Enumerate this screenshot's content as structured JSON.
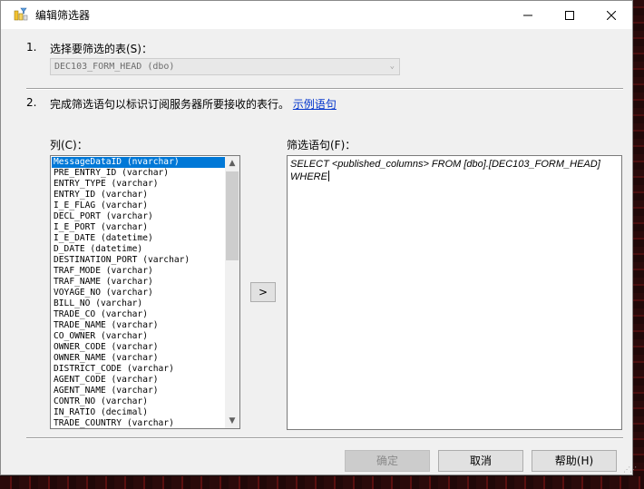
{
  "window": {
    "title": "编辑筛选器"
  },
  "step1": {
    "number": "1.",
    "label": "选择要筛选的表(S)：",
    "table_value": "DEC103_FORM_HEAD (dbo)"
  },
  "step2": {
    "number": "2.",
    "label": "完成筛选语句以标识订阅服务器所要接收的表行。",
    "link": "示例语句"
  },
  "columns": {
    "label": "列(C)：",
    "items": [
      "MessageDataID (nvarchar)",
      "PRE_ENTRY_ID (varchar)",
      "ENTRY_TYPE (varchar)",
      "ENTRY_ID (varchar)",
      "I_E_FLAG (varchar)",
      "DECL_PORT (varchar)",
      "I_E_PORT (varchar)",
      "I_E_DATE (datetime)",
      "D_DATE (datetime)",
      "DESTINATION_PORT (varchar)",
      "TRAF_MODE (varchar)",
      "TRAF_NAME (varchar)",
      "VOYAGE_NO (varchar)",
      "BILL_NO (varchar)",
      "TRADE_CO (varchar)",
      "TRADE_NAME (varchar)",
      "CO_OWNER (varchar)",
      "OWNER_CODE (varchar)",
      "OWNER_NAME (varchar)",
      "DISTRICT_CODE (varchar)",
      "AGENT_CODE (varchar)",
      "AGENT_NAME (varchar)",
      "CONTR_NO (varchar)",
      "IN_RATIO (decimal)",
      "TRADE_COUNTRY (varchar)"
    ],
    "selected_index": 0
  },
  "add_button": {
    "label": ">"
  },
  "filter": {
    "label": "筛选语句(F)：",
    "line1": "SELECT <published_columns> FROM [dbo].[DEC103_FORM_HEAD]",
    "line2": "WHERE"
  },
  "buttons": {
    "ok": "确定",
    "cancel": "取消",
    "help": "帮助(H)"
  }
}
